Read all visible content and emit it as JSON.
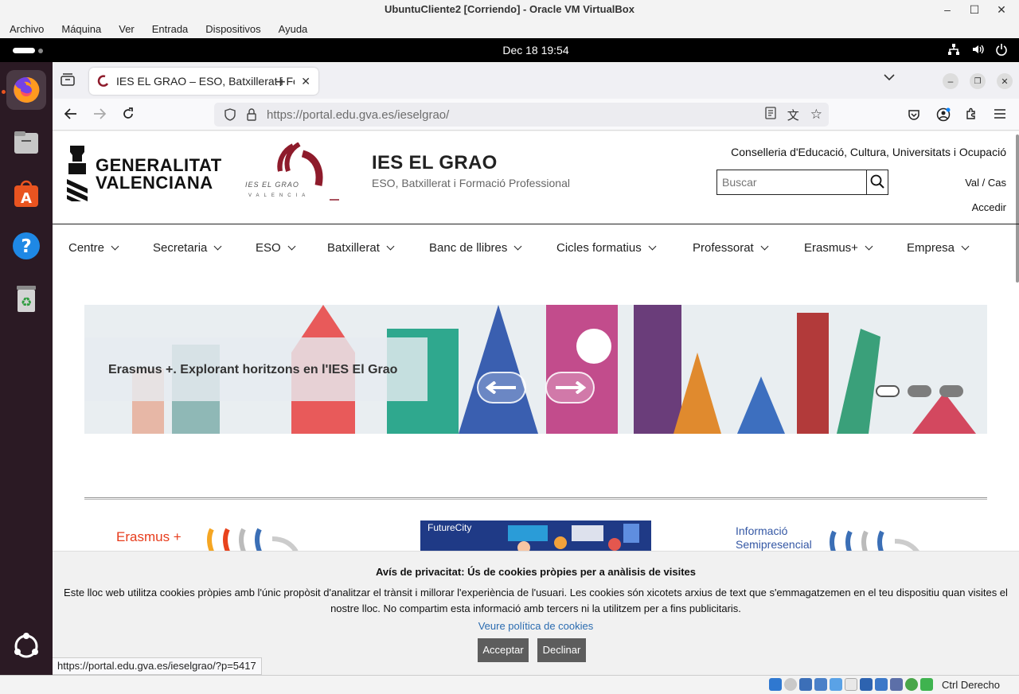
{
  "vbox": {
    "title": "UbuntuCliente2 [Corriendo] - Oracle VM VirtualBox",
    "menu": [
      "Archivo",
      "Máquina",
      "Ver",
      "Entrada",
      "Dispositivos",
      "Ayuda"
    ],
    "host_key": "Ctrl Derecho"
  },
  "ubuntu": {
    "clock": "Dec 18  19:54",
    "dock": [
      "firefox-icon",
      "files-icon",
      "app-center-icon",
      "help-icon",
      "trash-icon",
      "show-apps-icon"
    ]
  },
  "browser": {
    "tab_title": "IES EL GRAO – ESO, Batxillerat i Formació Professional",
    "url": "https://portal.edu.gva.es/ieselgrao/",
    "url_host": "gva.es",
    "status_url": "https://portal.edu.gva.es/ieselgrao/?p=5417"
  },
  "page": {
    "gv_line1": "GENERALITAT",
    "gv_line2": "VALENCIANA",
    "grao_logo_text": "IES EL GRAO",
    "grao_logo_sub": "VALENCIA",
    "title": "IES EL GRAO",
    "subtitle": "ESO, Batxillerat i Formació Professional",
    "conselleria": "Conselleria d'Educació, Cultura, Universitats i Ocupació",
    "search_placeholder": "Buscar",
    "lang": "Val / Cas",
    "login": "Accedir",
    "nav": [
      "Centre",
      "Secretaria",
      "ESO",
      "Batxillerat",
      "Banc de llibres",
      "Cicles formatius",
      "Professorat",
      "Erasmus+",
      "Empresa"
    ],
    "slide_caption": "Erasmus +. Explorant horitzons en l'IES El Grao",
    "slide_count": 3,
    "slide_active": 1,
    "tile_erasmus": "Erasmus +",
    "tile_future": "FutureCity",
    "tile_semi_line1": "Informació",
    "tile_semi_line2": "Semipresencial"
  },
  "cookie": {
    "title": "Avís de privacitat: Ús de cookies pròpies per a anàlisis de visites",
    "text": "Este lloc web utilitza cookies pròpies amb l'únic propòsit d'analitzar el trànsit i millorar l'experiència de l'usuari. Les cookies són xicotets arxius de text que s'emmagatzemen en el teu dispositiu quan visites el nostre lloc. No compartim esta informació amb tercers ni la utilitzem per a fins publicitaris.",
    "policy_link": "Veure política de cookies",
    "accept": "Acceptar",
    "decline": "Declinar"
  },
  "colors": {
    "grao_red": "#8e1b2b",
    "cookie_button": "#5d5d5d",
    "link_blue": "#2b6cb0",
    "erasmus_orange": "#e73c1c"
  }
}
